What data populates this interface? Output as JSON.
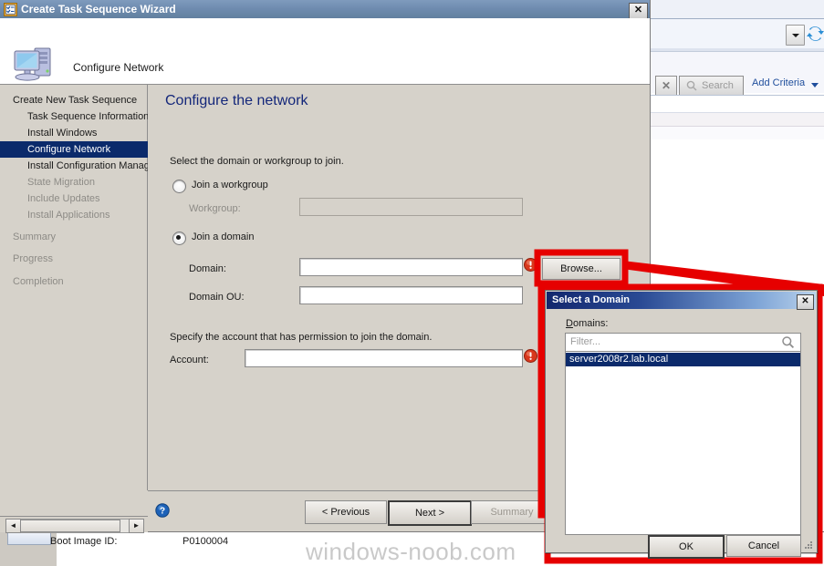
{
  "background_console": {
    "collapse_chevron": "◀",
    "dropdown_icon": "dropdown-arrow",
    "refresh_icon": "refresh-icon",
    "clear_button_glyph": "✕",
    "search_button_label": "Search",
    "add_criteria_label": "Add Criteria",
    "boot_image_label": "Boot Image ID:",
    "boot_image_value": "P0100004",
    "watermark": "windows-noob.com"
  },
  "wizard": {
    "title": "Create Task Sequence Wizard",
    "title_icon": "task-sequence-icon",
    "close_glyph": "✕",
    "header_text": "Configure Network",
    "header_icon": "computer-icon",
    "nav": [
      {
        "label": "Create New Task Sequence",
        "level": 0,
        "state": "normal"
      },
      {
        "label": "Task Sequence Information",
        "level": 1,
        "state": "normal"
      },
      {
        "label": "Install Windows",
        "level": 1,
        "state": "normal"
      },
      {
        "label": "Configure Network",
        "level": 1,
        "state": "selected"
      },
      {
        "label": "Install Configuration Manag",
        "level": 1,
        "state": "normal"
      },
      {
        "label": "State Migration",
        "level": 1,
        "state": "disabled"
      },
      {
        "label": "Include Updates",
        "level": 1,
        "state": "disabled"
      },
      {
        "label": "Install Applications",
        "level": 1,
        "state": "disabled"
      },
      {
        "label": "Summary",
        "level": 0,
        "state": "disabled"
      },
      {
        "label": "Progress",
        "level": 0,
        "state": "disabled"
      },
      {
        "label": "Completion",
        "level": 0,
        "state": "disabled"
      }
    ],
    "content": {
      "title": "Configure the network",
      "instruction": "Select the domain or workgroup to join.",
      "radio_workgroup_label": "Join a workgroup",
      "radio_workgroup_selected": false,
      "workgroup_label": "Workgroup:",
      "workgroup_value": "",
      "radio_domain_label": "Join a domain",
      "radio_domain_selected": true,
      "domain_label": "Domain:",
      "domain_value": "",
      "domain_ou_label": "Domain OU:",
      "domain_ou_value": "",
      "browse_button_label": "Browse...",
      "account_instruction": "Specify the account that has permission to join the domain.",
      "account_label": "Account:",
      "account_value": "",
      "error_icon": "error-icon"
    },
    "footer": {
      "help_icon": "help-icon",
      "previous_label": "< Previous",
      "next_label": "Next >",
      "summary_label": "Summary"
    },
    "scrollbar": {
      "left_arrow": "◄",
      "right_arrow": "►"
    }
  },
  "dialog": {
    "title": "Select a Domain",
    "close_glyph": "✕",
    "domains_label_accel": "D",
    "domains_label_rest": "omains:",
    "filter_placeholder": "Filter...",
    "search_icon": "search-icon",
    "items": [
      {
        "label": "server2008r2.lab.local",
        "selected": true
      }
    ],
    "ok_label": "OK",
    "cancel_label": "Cancel",
    "resize_grip": "resize-grip-icon"
  },
  "colors": {
    "annotation_red": "#e60000",
    "selection_blue": "#0b2a6b",
    "heading_blue": "#14277a",
    "dialog_face": "#d6d2ca"
  }
}
